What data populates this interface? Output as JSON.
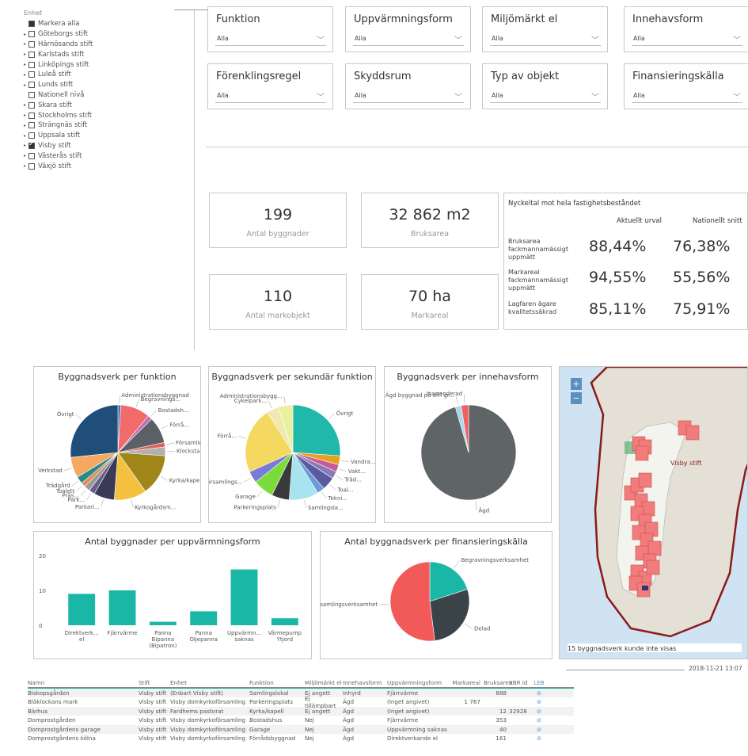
{
  "tree": {
    "header": "Enhet",
    "items": [
      {
        "label": "Markera alla",
        "arrow": false,
        "state": "sel"
      },
      {
        "label": "Göteborgs stift",
        "arrow": true,
        "state": ""
      },
      {
        "label": "Härnösands stift",
        "arrow": true,
        "state": ""
      },
      {
        "label": "Karlstads stift",
        "arrow": true,
        "state": ""
      },
      {
        "label": "Linköpings stift",
        "arrow": true,
        "state": ""
      },
      {
        "label": "Luleå stift",
        "arrow": true,
        "state": ""
      },
      {
        "label": "Lunds stift",
        "arrow": true,
        "state": ""
      },
      {
        "label": "Nationell nivå",
        "arrow": false,
        "state": ""
      },
      {
        "label": "Skara stift",
        "arrow": true,
        "state": ""
      },
      {
        "label": "Stockholms stift",
        "arrow": true,
        "state": ""
      },
      {
        "label": "Strängnäs stift",
        "arrow": true,
        "state": ""
      },
      {
        "label": "Uppsala stift",
        "arrow": true,
        "state": ""
      },
      {
        "label": "Visby stift",
        "arrow": true,
        "state": "chk"
      },
      {
        "label": "Västerås stift",
        "arrow": true,
        "state": ""
      },
      {
        "label": "Växjö stift",
        "arrow": true,
        "state": ""
      }
    ]
  },
  "filters": [
    {
      "title": "Funktion",
      "value": "Alla"
    },
    {
      "title": "Uppvärmningsform",
      "value": "Alla"
    },
    {
      "title": "Miljömärkt el",
      "value": "Alla"
    },
    {
      "title": "Innehavsform",
      "value": "Alla"
    },
    {
      "title": "Förenklingsregel",
      "value": "Alla"
    },
    {
      "title": "Skyddsrum",
      "value": "Alla"
    },
    {
      "title": "Typ av objekt",
      "value": "Alla"
    },
    {
      "title": "Finansieringskälla",
      "value": "Alla"
    }
  ],
  "kpis": [
    {
      "value": "199",
      "label": "Antal byggnader"
    },
    {
      "value": "32 862 m2",
      "label": "Bruksarea"
    },
    {
      "value": "110",
      "label": "Antal markobjekt"
    },
    {
      "value": "70 ha",
      "label": "Markareal"
    }
  ],
  "nyckeltal": {
    "title": "Nyckeltal mot hela fastighetsbeståndet",
    "col1": "Aktuellt urval",
    "col2": "Nationellt snitt",
    "rows": [
      {
        "label": "Bruksarea fackmannamässigt uppmätt",
        "a": "88,44%",
        "b": "76,38%"
      },
      {
        "label": "Markareal fackmannamässigt uppmätt",
        "a": "94,55%",
        "b": "55,56%"
      },
      {
        "label": "Lagfaren ägare kvalitetssäkrad",
        "a": "85,11%",
        "b": "75,91%"
      }
    ]
  },
  "charts": {
    "funktion_title": "Byggnadsverk per funktion",
    "sekundar_title": "Byggnadsverk per sekundär funktion",
    "innehav_title": "Byggnadsverk per innehavsform",
    "uppv_title": "Antal byggnader per uppvärmningsform",
    "finans_title": "Antal byggnadsverk per finansieringskälla"
  },
  "chart_data": [
    {
      "type": "pie",
      "title": "Byggnadsverk per funktion",
      "categories": [
        "Administrationsbyggnad",
        "Begravnings...",
        "Bostadsh...",
        "Förrå...",
        "Församling...",
        "Klockstapel/klo...",
        "Kyrka/kapell",
        "Kyrkogårdsm...",
        "Parkari...",
        "Park...",
        "Präs...",
        "Toalett",
        "Trädgård",
        "Verkstad",
        "Övrigt"
      ],
      "values": [
        2,
        20,
        3,
        18,
        3,
        6,
        28,
        22,
        14,
        4,
        4,
        3,
        5,
        14,
        53
      ],
      "colors": [
        "#4472c4",
        "#f26b6b",
        "#c06bb6",
        "#5a6066",
        "#e06060",
        "#b0b0b0",
        "#a08618",
        "#f4c040",
        "#3a3a55",
        "#6a5a8a",
        "#9a9a9a",
        "#e08a50",
        "#2a8a8a",
        "#f5a860",
        "#1f4e79"
      ]
    },
    {
      "type": "pie",
      "title": "Byggnadsverk per sekundär funktion",
      "categories": [
        "Övrigt",
        "Vandra...",
        "Vakt...",
        "Träd...",
        "Toal...",
        "Tekni...",
        "Samlingsla...",
        "Parkeringsplats",
        "Garage",
        "Församlings...",
        "Förrå...",
        "Cykelpark...",
        "Administrationsbygg..."
      ],
      "values": [
        52,
        6,
        5,
        5,
        9,
        5,
        20,
        12,
        14,
        8,
        45,
        8,
        10
      ],
      "colors": [
        "#1fb8aa",
        "#e8a020",
        "#c85a98",
        "#8a7ab8",
        "#5a5aa0",
        "#6a9ad8",
        "#a8e4f0",
        "#3a3a3a",
        "#7adb3a",
        "#7a7ad8",
        "#f4d860",
        "#f0e8b0",
        "#e9f0a0"
      ]
    },
    {
      "type": "pie",
      "title": "Byggnadsverk per innehavsform",
      "categories": [
        "Ägd",
        "Ägd byggnad på ofri gr...",
        "Inarrenderad"
      ],
      "values": [
        190,
        4,
        5
      ],
      "colors": [
        "#5f6567",
        "#a8d8f0",
        "#f06060"
      ]
    },
    {
      "type": "bar",
      "title": "Antal byggnader per uppvärmningsform",
      "categories": [
        "Direktverk... el",
        "Fjärrvärme",
        "Panna Bipanna (Bipatron)",
        "Panna Oljepanna",
        "Uppvärmn... saknas",
        "Värmepump Ytjord"
      ],
      "values": [
        9,
        10,
        1,
        4,
        16,
        2
      ],
      "ylim": [
        0,
        20
      ],
      "yticks": [
        "20",
        "10",
        "0"
      ],
      "color": "#1ab6a6"
    },
    {
      "type": "pie",
      "title": "Antal byggnadsverk per finansieringskälla",
      "categories": [
        "Begravningsverksamhet",
        "Delad",
        "Församlingsverksamhet"
      ],
      "values": [
        20,
        28,
        52
      ],
      "colors": [
        "#1ab6a6",
        "#3a4448",
        "#f25a5a"
      ]
    }
  ],
  "map": {
    "zoom_in": "+",
    "zoom_out": "−",
    "region_label": "Visby stift",
    "note": "15 byggnadsverk kunde inte visas"
  },
  "timestamp": "2018-11-21 13:07",
  "grid": {
    "headers": [
      "Namn",
      "Stift",
      "Enhet",
      "Funktion",
      "Miljömärkt el",
      "Innehavsform",
      "Uppvärmningsform",
      "Markareal",
      "Bruksarea",
      "KBR id",
      "LEB"
    ],
    "rows": [
      [
        "Biskopsgården",
        "Visby stift",
        "(Enbart Visby stift)",
        "Samlingslokal",
        "Ej angett",
        "Inhyrd",
        "Fjärrvärme",
        "",
        "888",
        "",
        "⊘"
      ],
      [
        "Bläklockans mark",
        "Visby stift",
        "Visby domkyrkoförsamling",
        "Parkeringsplats",
        "Ej tillämpbart",
        "Ägd",
        "(Inget angivet)",
        "1 767",
        "",
        "",
        "⊘"
      ],
      [
        "Bärhus",
        "Visby stift",
        "Fardhems pastorat",
        "Kyrka/kapell",
        "Ej angett",
        "Ägd",
        "(Inget angivet)",
        "",
        "12",
        "32928",
        "⊘"
      ],
      [
        "Domprostgården",
        "Visby stift",
        "Visby domkyrkoförsamling",
        "Bostadshus",
        "Nej",
        "Ägd",
        "Fjärrvärme",
        "",
        "353",
        "",
        "⊘"
      ],
      [
        "Domprostgårdens garage",
        "Visby stift",
        "Visby domkyrkoförsamling",
        "Garage",
        "Nej",
        "Ägd",
        "Uppvärmning saknas",
        "",
        "40",
        "",
        "⊘"
      ],
      [
        "Domprostgårdens kölna",
        "Visby stift",
        "Visby domkyrkoförsamling",
        "Förrådsbyggnad",
        "Nej",
        "Ägd",
        "Direktverkande el",
        "",
        "161",
        "",
        "⊘"
      ]
    ]
  }
}
